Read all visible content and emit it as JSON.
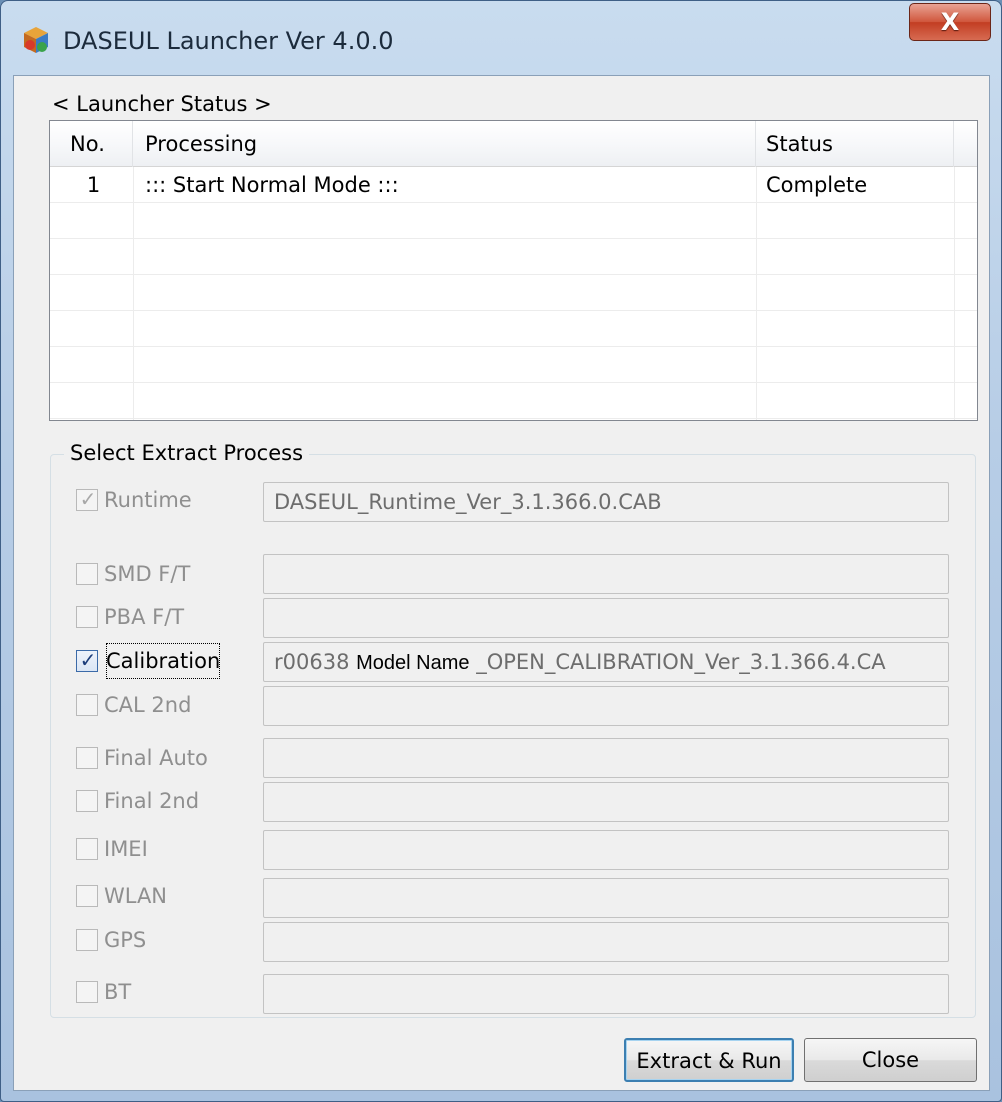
{
  "window": {
    "title": "DASEUL Launcher Ver 4.0.0",
    "close_glyph": "X"
  },
  "status": {
    "label": "< Launcher Status >",
    "columns": [
      "No.",
      "Processing",
      "Status"
    ],
    "rows": [
      {
        "no": "1",
        "processing": "::: Start Normal Mode :::",
        "status": "Complete"
      }
    ]
  },
  "extract": {
    "group_title": "Select Extract Process",
    "options": [
      {
        "label": "Runtime",
        "checked": true,
        "enabled": false,
        "value": "DASEUL_Runtime_Ver_3.1.366.0.CAB"
      },
      {
        "label": "SMD F/T",
        "checked": false,
        "enabled": false,
        "value": ""
      },
      {
        "label": "PBA F/T",
        "checked": false,
        "enabled": false,
        "value": ""
      },
      {
        "label": "Calibration",
        "checked": true,
        "enabled": true,
        "value_prefix": "r00638",
        "value_overlay": "Model Name",
        "value_suffix": "_OPEN_CALIBRATION_Ver_3.1.366.4.CA"
      },
      {
        "label": "CAL 2nd",
        "checked": false,
        "enabled": false,
        "value": ""
      },
      {
        "label": "Final Auto",
        "checked": false,
        "enabled": false,
        "value": ""
      },
      {
        "label": "Final 2nd",
        "checked": false,
        "enabled": false,
        "value": ""
      },
      {
        "label": "IMEI",
        "checked": false,
        "enabled": false,
        "value": ""
      },
      {
        "label": "WLAN",
        "checked": false,
        "enabled": false,
        "value": ""
      },
      {
        "label": "GPS",
        "checked": false,
        "enabled": false,
        "value": ""
      },
      {
        "label": "BT",
        "checked": false,
        "enabled": false,
        "value": ""
      }
    ]
  },
  "buttons": {
    "extract_run": "Extract & Run",
    "close": "Close"
  },
  "icons": {
    "app": "app-package-icon",
    "check": "checkmark-icon"
  },
  "colors": {
    "title_close": "#c23d22",
    "accent": "#3c7fb1"
  }
}
